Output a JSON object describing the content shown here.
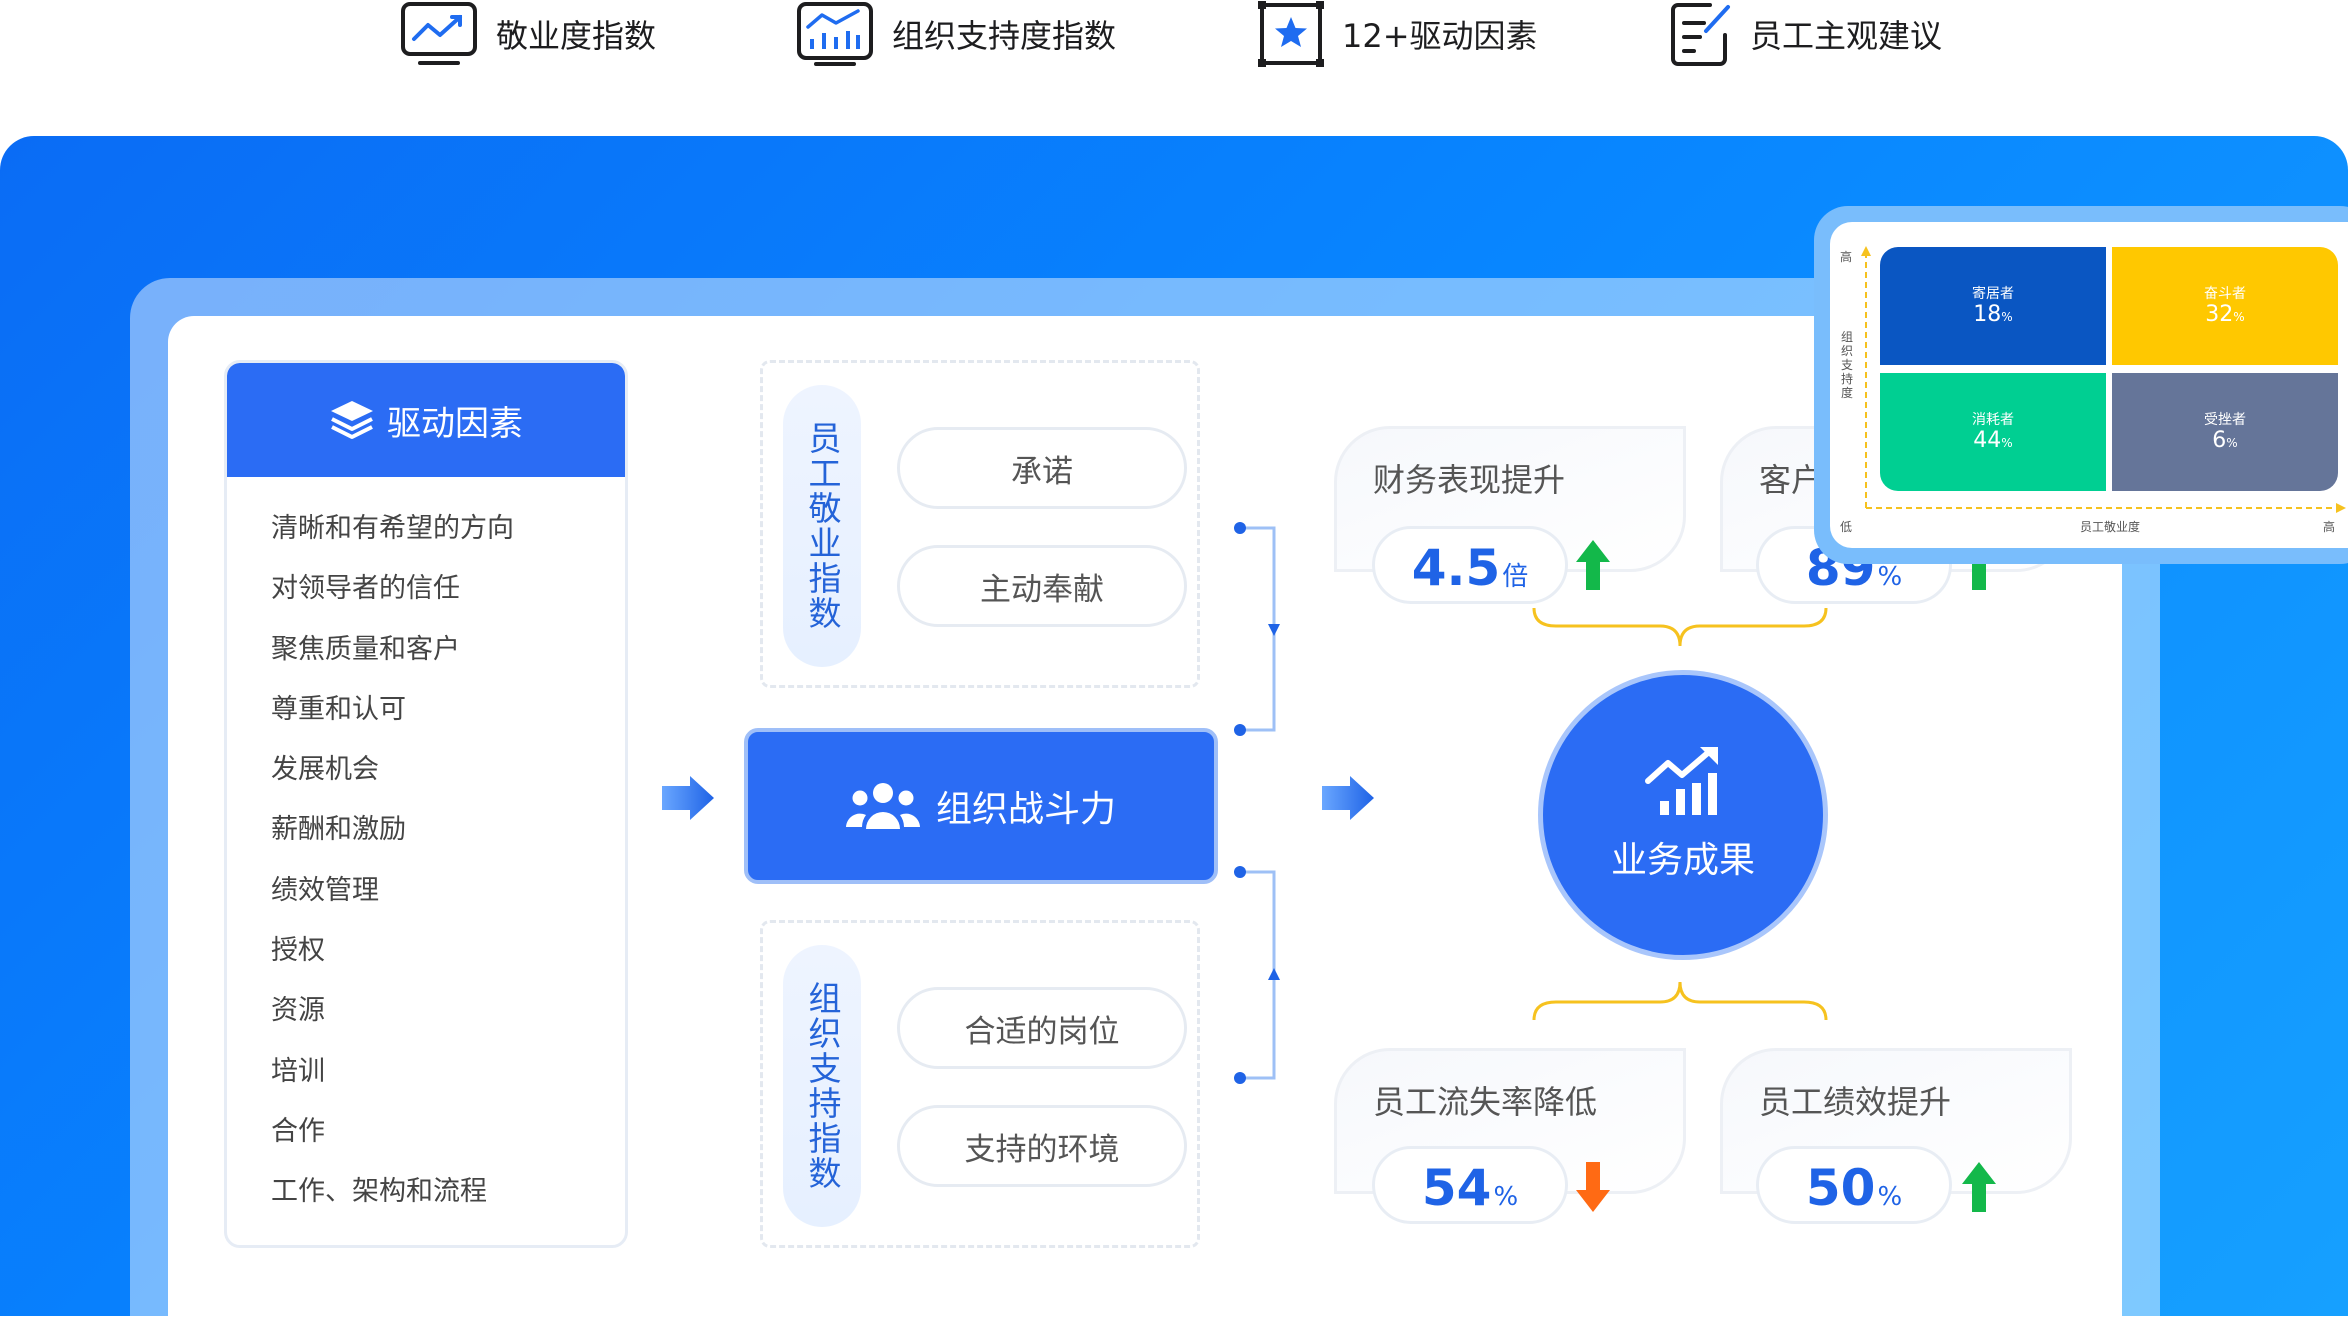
{
  "features": [
    {
      "label": "敬业度指数",
      "icon": "monitor-trend-icon"
    },
    {
      "label": "组织支持度指数",
      "icon": "monitor-bars-icon"
    },
    {
      "label": "12+驱动因素",
      "icon": "star-frame-icon"
    },
    {
      "label": "员工主观建议",
      "icon": "note-edit-icon"
    }
  ],
  "drivers": {
    "title": "驱动因素",
    "items": [
      "清晰和有希望的方向",
      "对领导者的信任",
      "聚焦质量和客户",
      "尊重和认可",
      "发展机会",
      "薪酬和激励",
      "绩效管理",
      "授权",
      "资源",
      "培训",
      "合作",
      "工作、架构和流程"
    ]
  },
  "engagement": {
    "label": "员工敬业指数",
    "items": [
      "承诺",
      "主动奉献"
    ]
  },
  "core": {
    "label": "组织战斗力"
  },
  "support": {
    "label": "组织支持指数",
    "items": [
      "合适的岗位",
      "支持的环境"
    ]
  },
  "outcome": {
    "label": "业务成果"
  },
  "results": [
    {
      "title": "财务表现提升",
      "value": "4.5",
      "unit": "倍",
      "trend": "up"
    },
    {
      "title": "客户",
      "value": "89",
      "unit": "%",
      "trend": "up"
    },
    {
      "title": "员工流失率降低",
      "value": "54",
      "unit": "%",
      "trend": "down"
    },
    {
      "title": "员工绩效提升",
      "value": "50",
      "unit": "%",
      "trend": "up"
    }
  ],
  "quadrant": {
    "y_axis": "组织支持度",
    "x_axis": "员工敬业度",
    "high": "高",
    "low": "低",
    "cells": [
      {
        "name": "寄居者",
        "value": "18",
        "unit": "%",
        "color": "#0a56c2"
      },
      {
        "name": "奋斗者",
        "value": "32",
        "unit": "%",
        "color": "#ffc800"
      },
      {
        "name": "消耗者",
        "value": "44",
        "unit": "%",
        "color": "#00cf92"
      },
      {
        "name": "受挫者",
        "value": "6",
        "unit": "%",
        "color": "#657599"
      }
    ]
  },
  "colors": {
    "brand_blue": "#2b6cf4",
    "up_green": "#13b84a",
    "down_orange": "#ff6a14",
    "bracket_yellow": "#f6c21f"
  }
}
